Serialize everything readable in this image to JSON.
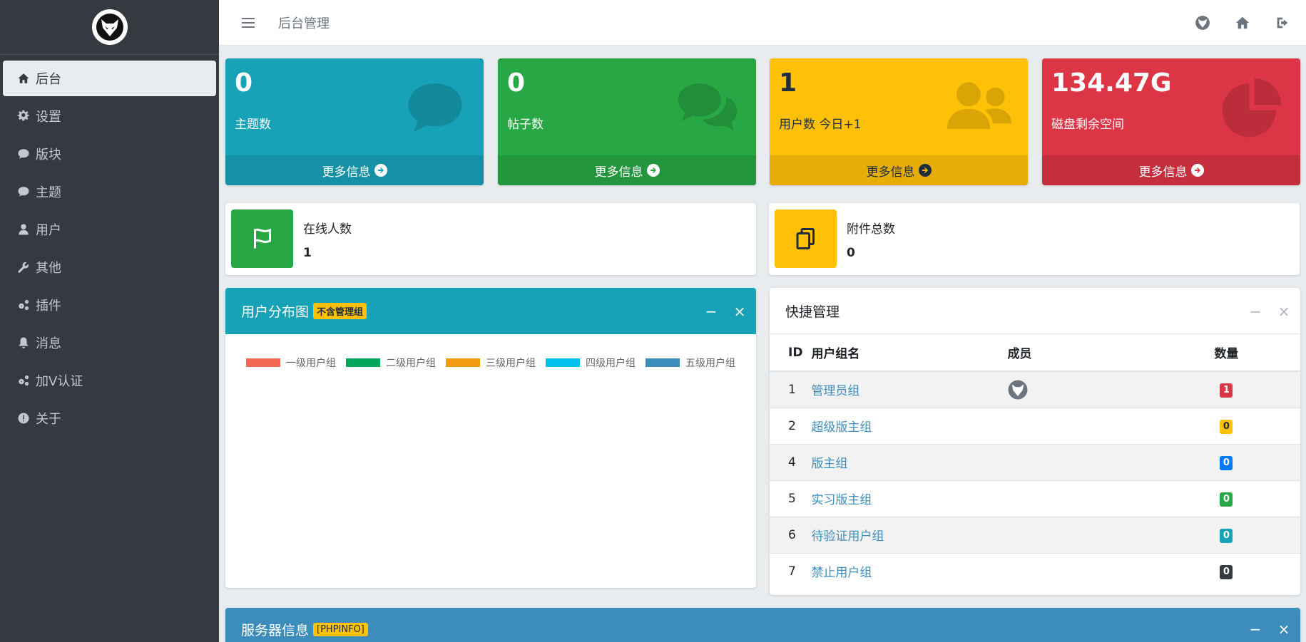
{
  "sidebar": {
    "items": [
      {
        "label": "后台",
        "icon": "home-icon"
      },
      {
        "label": "设置",
        "icon": "gear-icon"
      },
      {
        "label": "版块",
        "icon": "comment-icon"
      },
      {
        "label": "主题",
        "icon": "comment-icon"
      },
      {
        "label": "用户",
        "icon": "user-icon"
      },
      {
        "label": "其他",
        "icon": "wrench-icon"
      },
      {
        "label": "插件",
        "icon": "gears-icon"
      },
      {
        "label": "消息",
        "icon": "bell-icon"
      },
      {
        "label": "加V认证",
        "icon": "gears-icon"
      },
      {
        "label": "关于",
        "icon": "exclamation-circle-icon"
      }
    ]
  },
  "header": {
    "title": "后台管理"
  },
  "stats": [
    {
      "value": "0",
      "label": "主题数",
      "more": "更多信息",
      "color": "#17a2b8",
      "icon": "comment-icon"
    },
    {
      "value": "0",
      "label": "帖子数",
      "more": "更多信息",
      "color": "#28a745",
      "icon": "comments-icon"
    },
    {
      "value": "1",
      "label": "用户数 今日+1",
      "more": "更多信息",
      "color": "#ffc107",
      "icon": "users-icon"
    },
    {
      "value": "134.47G",
      "label": "磁盘剩余空间",
      "more": "更多信息",
      "color": "#dc3545",
      "icon": "pie-chart-icon"
    }
  ],
  "info_boxes": [
    {
      "title": "在线人数",
      "value": "1",
      "color": "#28a745",
      "icon": "flag-icon"
    },
    {
      "title": "附件总数",
      "value": "0",
      "color": "#ffc107",
      "icon": "copy-icon"
    }
  ],
  "user_chart": {
    "title": "用户分布图",
    "badge": "不含管理组",
    "minimize": "−",
    "close": "×"
  },
  "chart_data": {
    "type": "pie",
    "series": [
      {
        "name": "一级用户组",
        "color": "#f56954"
      },
      {
        "name": "二级用户组",
        "color": "#00a65a"
      },
      {
        "name": "三级用户组",
        "color": "#f39c12"
      },
      {
        "name": "四级用户组",
        "color": "#00c0ef"
      },
      {
        "name": "五级用户组",
        "color": "#3c8dbc"
      }
    ]
  },
  "quick": {
    "title": "快捷管理",
    "minimize": "−",
    "close": "×",
    "columns": [
      "ID",
      "用户组名",
      "成员",
      "数量"
    ],
    "rows": [
      {
        "id": "1",
        "name": "管理员组",
        "avatar": true,
        "count": "1",
        "cls": "c-danger"
      },
      {
        "id": "2",
        "name": "超级版主组",
        "avatar": false,
        "count": "0",
        "cls": "c-warning"
      },
      {
        "id": "4",
        "name": "版主组",
        "avatar": false,
        "count": "0",
        "cls": "c-primary"
      },
      {
        "id": "5",
        "name": "实习版主组",
        "avatar": false,
        "count": "0",
        "cls": "c-success"
      },
      {
        "id": "6",
        "name": "待验证用户组",
        "avatar": false,
        "count": "0",
        "cls": "c-info"
      },
      {
        "id": "7",
        "name": "禁止用户组",
        "avatar": false,
        "count": "0",
        "cls": "c-dark"
      }
    ]
  },
  "server": {
    "title": "服务器信息",
    "badge": "[PHPINFO]",
    "minimize": "−",
    "close": "×"
  }
}
